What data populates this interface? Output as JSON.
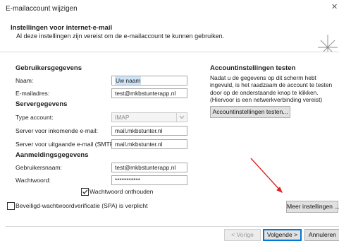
{
  "window": {
    "title": "E-mailaccount wijzigen",
    "close_label": "✕"
  },
  "header": {
    "title": "Instellingen voor internet-e-mail",
    "subtitle": "Al deze instellingen zijn vereist om de e-mailaccount te kunnen gebruiken.",
    "icon": "star-sparkle-icon"
  },
  "user_info": {
    "heading": "Gebruikersgegevens",
    "name_label": "Naam:",
    "name_value": "Uw naam",
    "email_label": "E-mailadres:",
    "email_value": "test@mkbstunterapp.nl"
  },
  "server_info": {
    "heading": "Servergegevens",
    "account_type_label": "Type account:",
    "account_type_value": "IMAP",
    "incoming_label": "Server voor inkomende e-mail:",
    "incoming_value": "mail.mkbstunter.nl",
    "outgoing_label": "Server voor uitgaande e-mail (SMTP):",
    "outgoing_value": "mail.mkbstunter.nl"
  },
  "login_info": {
    "heading": "Aanmeldingsgegevens",
    "username_label": "Gebruikersnaam:",
    "username_value": "test@mkbstunterapp.nl",
    "password_label": "Wachtwoord:",
    "password_value": "***********",
    "remember_label": "Wachtwoord onthouden",
    "remember_checked": true,
    "spa_label": "Beveiligd-wachtwoordverificatie (SPA) is verplicht",
    "spa_checked": false
  },
  "test_settings": {
    "heading": "Accountinstellingen testen",
    "description": "Nadat u de gegevens op dit scherm hebt ingevuld, is het raadzaam de account te testen door op de onderstaande knop te klikken. (Hiervoor is een netwerkverbinding vereist)",
    "test_button": "Accountinstellingen testen..."
  },
  "more_settings_button": "Meer instellingen ...",
  "annotation": {
    "color": "#e02020"
  },
  "footer": {
    "back_button": "< Vorige",
    "next_button": "Volgende >",
    "cancel_button": "Annuleren"
  }
}
